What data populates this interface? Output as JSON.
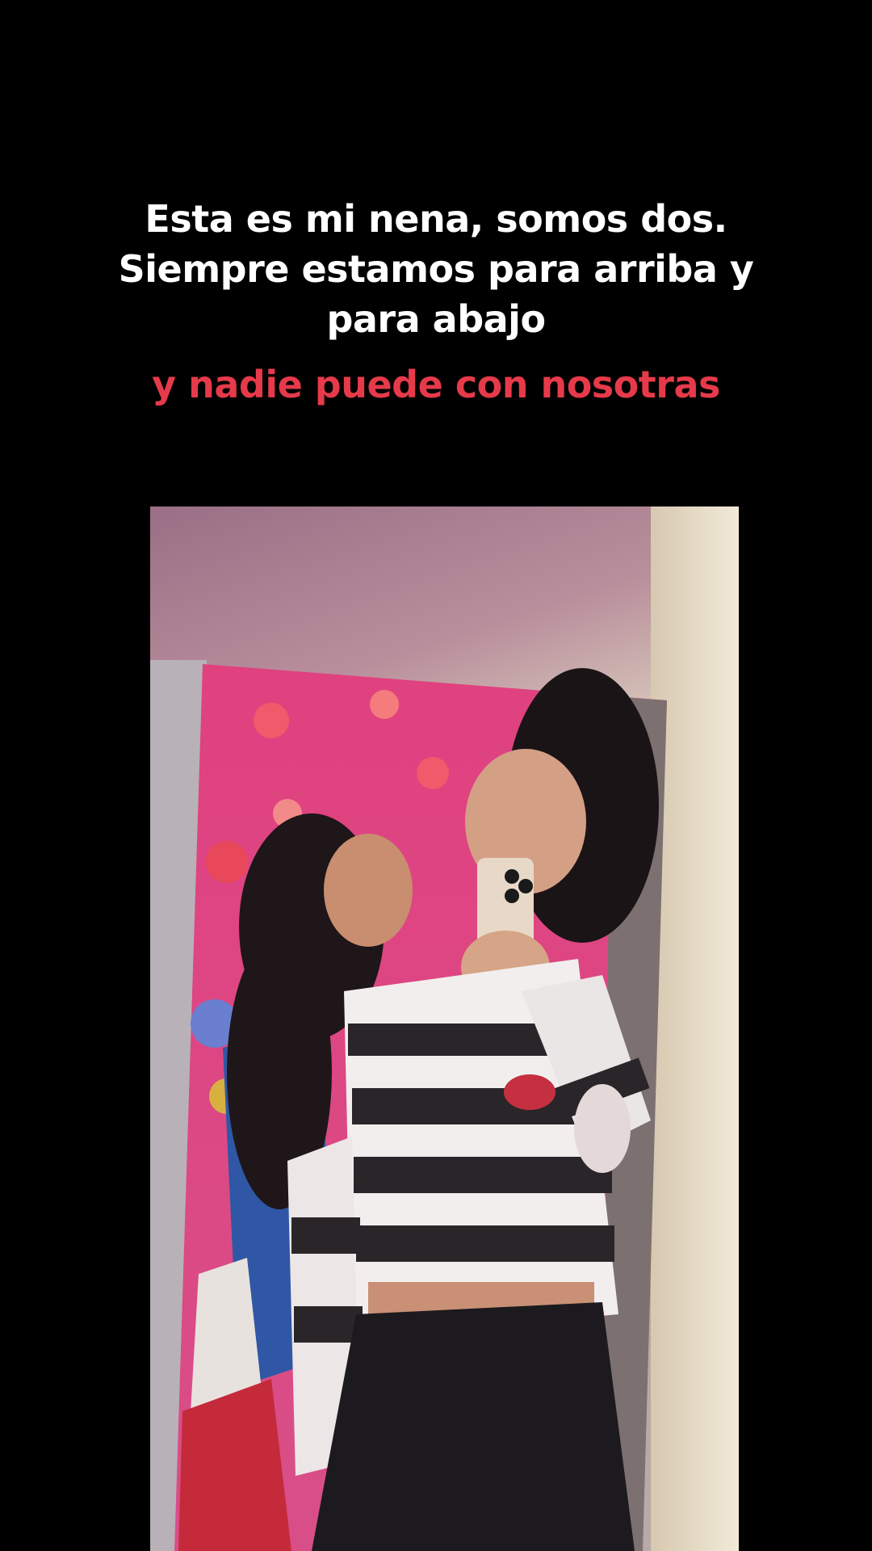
{
  "overlay": {
    "caption_lines": [
      "Esta es mi nena, somos dos.",
      "Siempre estamos para arriba y",
      "para abajo"
    ],
    "caption_accent": "y nadie puede con nosotras"
  },
  "colors": {
    "background": "#000000",
    "caption_text": "#ffffff",
    "accent_text": "#e63a4a"
  },
  "photo": {
    "subject": "mirror-selfie-two-girls"
  }
}
